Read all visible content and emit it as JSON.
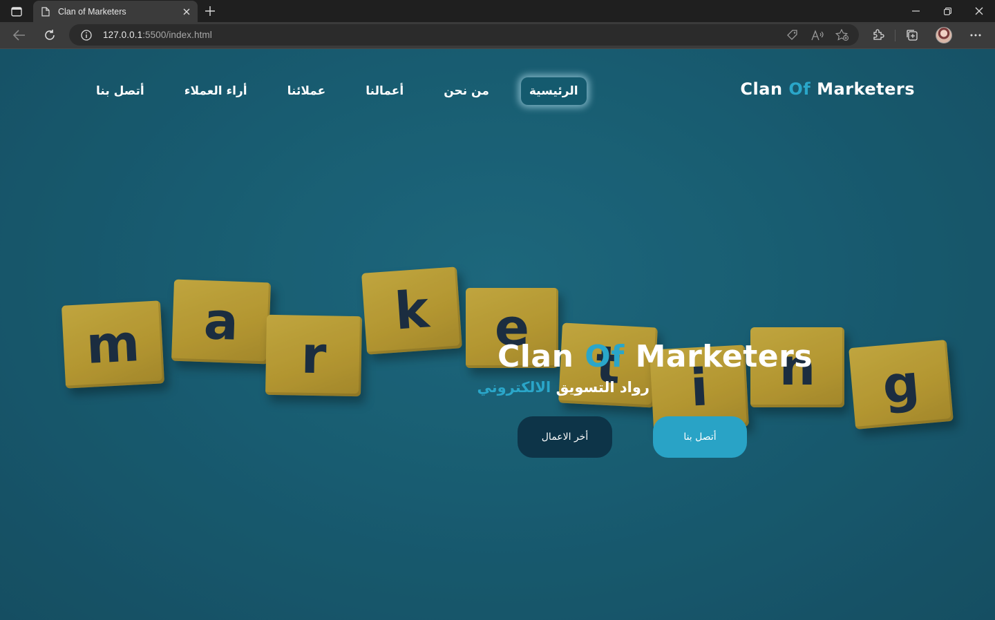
{
  "browser": {
    "tab_title": "Clan of Marketers",
    "url_host": "127.0.0.1",
    "url_path": ":5500/index.html",
    "icons": [
      "sidebar-toggle-icon",
      "page-icon",
      "close-icon",
      "plus-icon",
      "minimize-icon",
      "restore-icon",
      "close-window-icon",
      "back-icon",
      "refresh-icon",
      "info-icon",
      "tag-icon",
      "read-aloud-icon",
      "favorite-add-icon",
      "extensions-icon",
      "collections-icon",
      "avatar",
      "more-icon"
    ]
  },
  "header": {
    "brand_clan": "Clan",
    "brand_of": "Of",
    "brand_marketers": "Marketers",
    "nav": [
      {
        "label": "الرئيسية",
        "active": true
      },
      {
        "label": "من نحن",
        "active": false
      },
      {
        "label": "أعمالنا",
        "active": false
      },
      {
        "label": "عملائنا",
        "active": false
      },
      {
        "label": "أراء العملاء",
        "active": false
      },
      {
        "label": "أتصل بنا",
        "active": false
      }
    ]
  },
  "hero": {
    "title_clan": "Clan",
    "title_of": "Of",
    "title_marketers": "Marketers",
    "subtitle_main": "رواد التسويق",
    "subtitle_accent": "الالكتروني",
    "btn_works": "أخر الاعمال",
    "btn_contact": "أتصل بنا",
    "background_tiles": [
      "m",
      "a",
      "r",
      "k",
      "e",
      "t",
      "i",
      "n",
      "g"
    ]
  },
  "colors": {
    "page_bg": "#1a5f73",
    "accent": "#2aa6c9",
    "dark_button": "#0d3448",
    "light_button": "#29a3c6",
    "tile": "#d0a82e"
  }
}
